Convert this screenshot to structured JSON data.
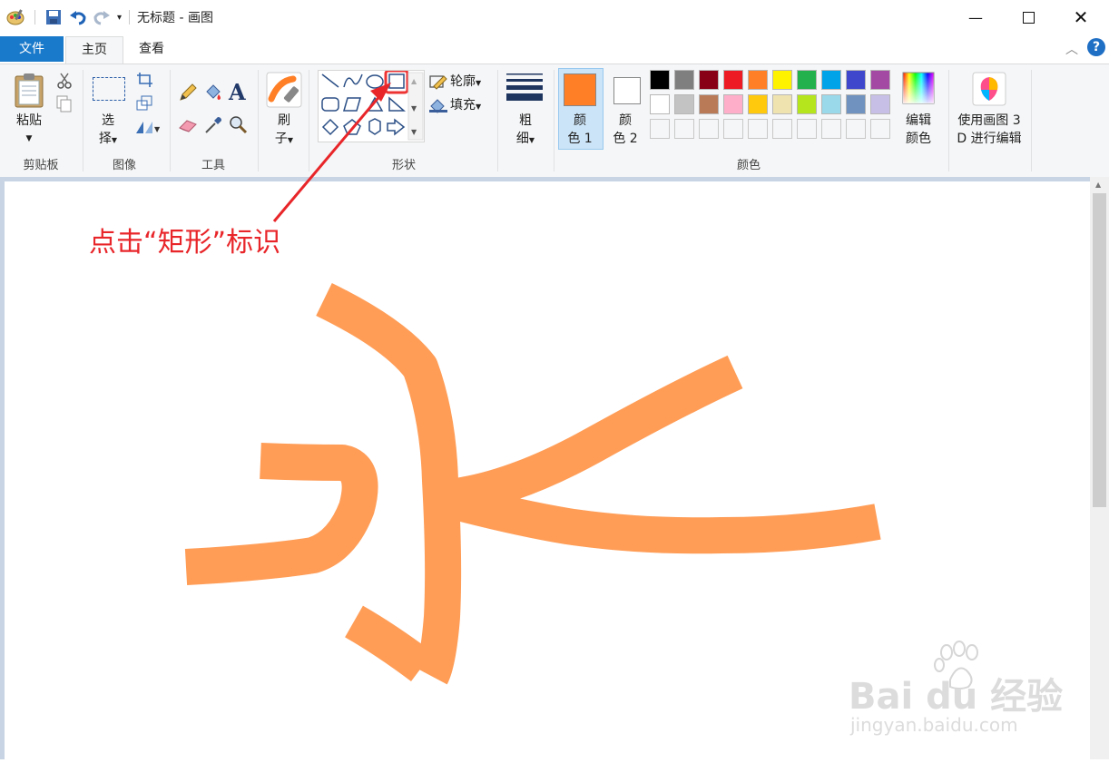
{
  "window": {
    "title": "无标题 - 画图",
    "controls": [
      "minimize",
      "maximize",
      "close"
    ]
  },
  "tabs": [
    {
      "label": "文件"
    },
    {
      "label": "主页"
    },
    {
      "label": "查看"
    }
  ],
  "groups": {
    "clipboard": {
      "label": "剪贴板",
      "paste_label": "粘贴"
    },
    "image": {
      "label": "图像",
      "select_label_1": "选",
      "select_label_2": "择"
    },
    "tools": {
      "label": "工具"
    },
    "brushes": {
      "label_1": "刷",
      "label_2": "子"
    },
    "shapes": {
      "label": "形状",
      "outline_label": "轮廓",
      "fill_label": "填充"
    },
    "size": {
      "label_1": "粗",
      "label_2": "细"
    },
    "colors": {
      "label": "颜色",
      "color1_label_1": "颜",
      "color1_label_2": "色 1",
      "color2_label_1": "颜",
      "color2_label_2": "色 2",
      "edit_label_1": "编辑",
      "edit_label_2": "颜色",
      "color1": "#ff7f27",
      "color2": "#ffffff",
      "palette_row1": [
        "#000000",
        "#7f7f7f",
        "#880015",
        "#ed1c24",
        "#ff7f27",
        "#fff200",
        "#22b14c",
        "#00a2e8",
        "#3f48cc",
        "#a349a4"
      ],
      "palette_row2": [
        "#ffffff",
        "#c3c3c3",
        "#b97a57",
        "#ffaec9",
        "#ffc90e",
        "#efe4b0",
        "#b5e61d",
        "#99d9ea",
        "#7092be",
        "#c8bfe7"
      ]
    },
    "paint3d": {
      "label_1": "使用画图 3",
      "label_2": "D 进行编辑"
    }
  },
  "annotation": {
    "text": "点击“矩形”标识",
    "color": "#e8262a"
  },
  "canvas": {
    "stroke_color": "#ff8c3a"
  },
  "watermark": {
    "brand": "Bai du 经验",
    "url": "jingyan.baidu.com"
  }
}
